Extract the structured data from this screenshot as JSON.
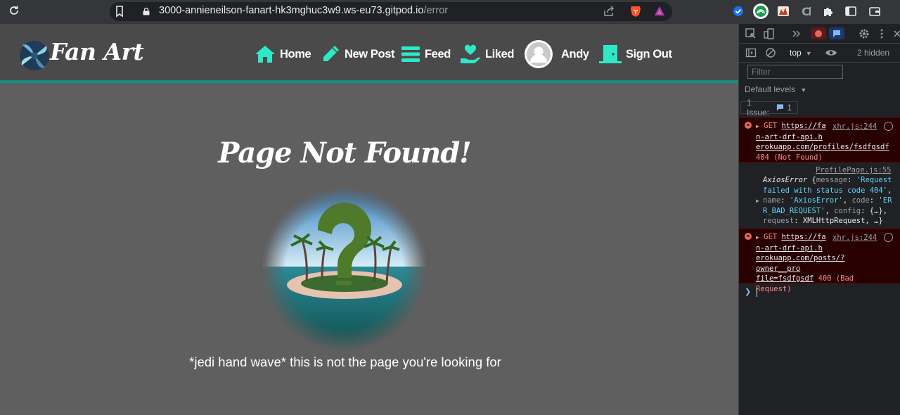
{
  "browser": {
    "url_host": "3000-annieneilson-fanart-hk3mghuc3w9.ws-eu73.gitpod.io",
    "url_path": "/error"
  },
  "site": {
    "brand": "Fan Art",
    "nav": {
      "home": "Home",
      "new_post": "New Post",
      "feed": "Feed",
      "liked": "Liked",
      "profile": "Andy",
      "sign_out": "Sign Out"
    },
    "title": "Page Not Found!",
    "message": "*jedi hand wave* this is not the page you're looking for",
    "accent": "#2ee8c8"
  },
  "devtools": {
    "context": "top",
    "hidden_count": "2 hidden",
    "filter_placeholder": "Filter",
    "levels": "Default levels",
    "issues_label": "1 Issue:",
    "issues_count": "1",
    "messages": [
      {
        "method": "GET",
        "url_part1": "https://fa",
        "url_part2": "n-art-drf-api.h",
        "url_part3": "erokuapp.com/profiles/fsdfgsdf",
        "status": "404 (Not Found)",
        "source": "xhr.js:244"
      },
      {
        "source": "ProfilePage.js:55",
        "class": "AxiosError",
        "k_message": "message",
        "v_message1": "'Request",
        "v_message2": "failed with status code 404'",
        "k_name": "name",
        "v_name": "'AxiosError'",
        "k_code": "code",
        "v_code1": "'ER",
        "v_code2": "R_BAD_REQUEST'",
        "k_config": "config",
        "v_config": "{…},",
        "k_request": "request",
        "v_request": "XMLHttpRequest, …}"
      },
      {
        "method": "GET",
        "url_part1": "https://fa",
        "url_part2": "n-art-drf-api.h",
        "url_part3": "erokuapp.com/posts/?owner__pro",
        "url_part4": "file=fsdfgsdf",
        "status_a": "400 (Bad",
        "status_b": "Request)",
        "source": "xhr.js:244"
      }
    ]
  }
}
